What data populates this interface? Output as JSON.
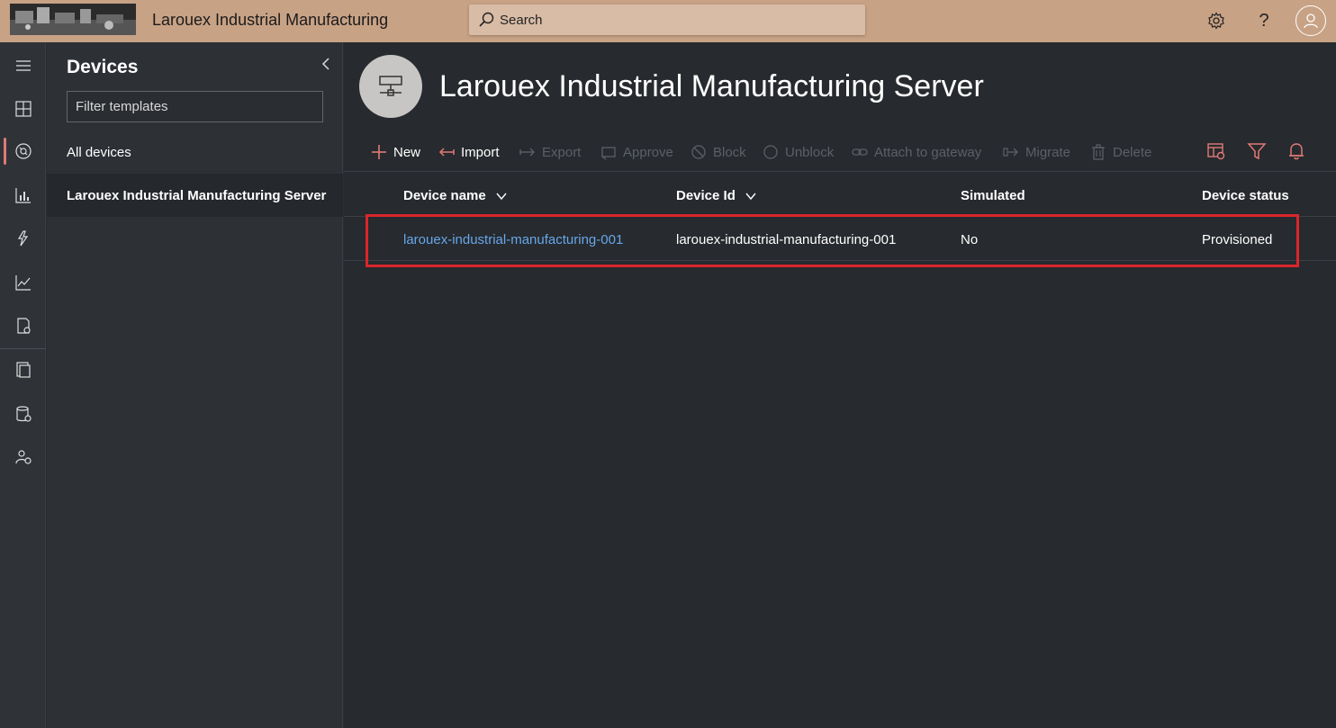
{
  "header": {
    "app_title": "Larouex Industrial Manufacturing",
    "search_placeholder": "Search"
  },
  "icons": {
    "settings": "gear-icon",
    "help": "question-icon",
    "account": "user-icon"
  },
  "rail": {
    "items": [
      "menu-icon",
      "dashboard-icon",
      "devices-icon",
      "analytics-icon",
      "rules-icon",
      "chart-icon",
      "jobs-icon",
      "device-templates-icon",
      "data-export-icon",
      "administration-icon"
    ],
    "active_item": "devices-icon"
  },
  "sidepanel": {
    "title": "Devices",
    "filter_placeholder": "Filter templates",
    "items": [
      {
        "label": "All devices",
        "selected": false
      },
      {
        "label": "Larouex Industrial Manufacturing Server",
        "selected": true
      }
    ]
  },
  "main": {
    "title": "Larouex Industrial Manufacturing Server",
    "toolbar": {
      "new": "New",
      "import": "Import",
      "export": "Export",
      "approve": "Approve",
      "block": "Block",
      "unblock": "Unblock",
      "attach": "Attach to gateway",
      "migrate": "Migrate",
      "delete": "Delete"
    },
    "table": {
      "columns": [
        "Device name",
        "Device Id",
        "Simulated",
        "Device status"
      ],
      "rows": [
        {
          "device_name": "larouex-industrial-manufacturing-001",
          "device_id": "larouex-industrial-manufacturing-001",
          "simulated": "No",
          "device_status": "Provisioned"
        }
      ]
    }
  },
  "colors": {
    "topbar": "#c8a285",
    "accent": "#e07a76",
    "link": "#66a7ea",
    "highlight": "#d9262c"
  }
}
